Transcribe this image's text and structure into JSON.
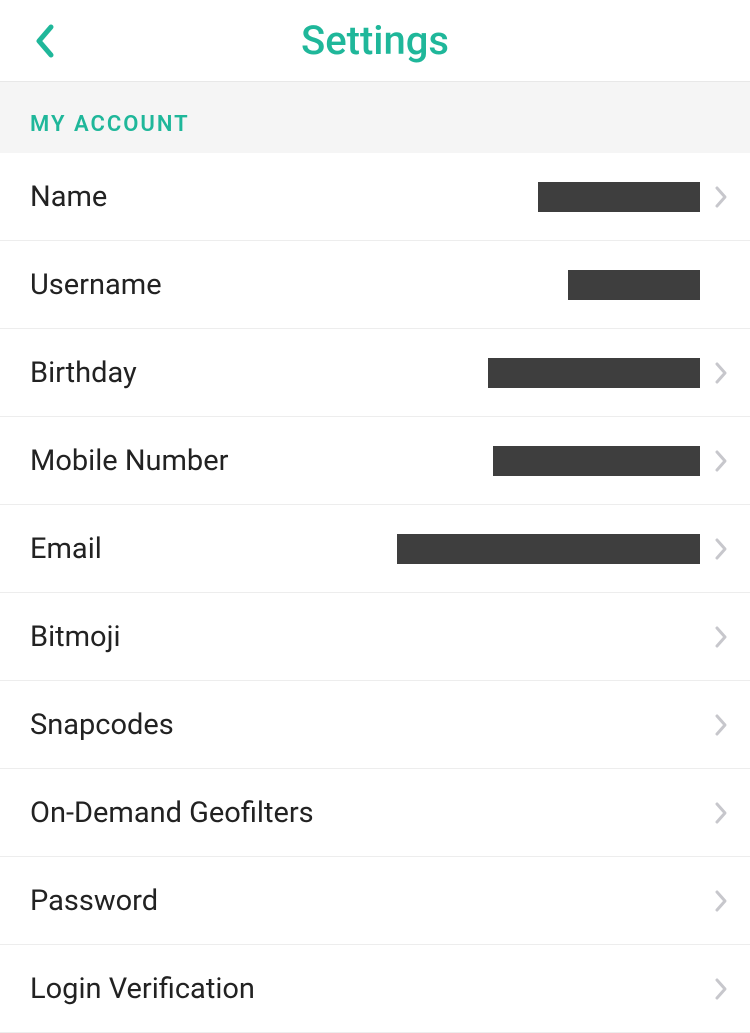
{
  "header": {
    "title": "Settings"
  },
  "section": {
    "label": "MY ACCOUNT"
  },
  "rows": [
    {
      "label": "Name",
      "valueWidth": 162,
      "chevron": true
    },
    {
      "label": "Username",
      "valueWidth": 132,
      "chevron": false
    },
    {
      "label": "Birthday",
      "valueWidth": 212,
      "chevron": true
    },
    {
      "label": "Mobile Number",
      "valueWidth": 207,
      "chevron": true
    },
    {
      "label": "Email",
      "valueWidth": 303,
      "chevron": true
    },
    {
      "label": "Bitmoji",
      "valueWidth": 0,
      "chevron": true
    },
    {
      "label": "Snapcodes",
      "valueWidth": 0,
      "chevron": true
    },
    {
      "label": "On-Demand Geofilters",
      "valueWidth": 0,
      "chevron": true
    },
    {
      "label": "Password",
      "valueWidth": 0,
      "chevron": true
    },
    {
      "label": "Login Verification",
      "valueWidth": 0,
      "chevron": true
    }
  ],
  "colors": {
    "accent": "#1fb79a",
    "redacted": "#3e3e3e"
  }
}
